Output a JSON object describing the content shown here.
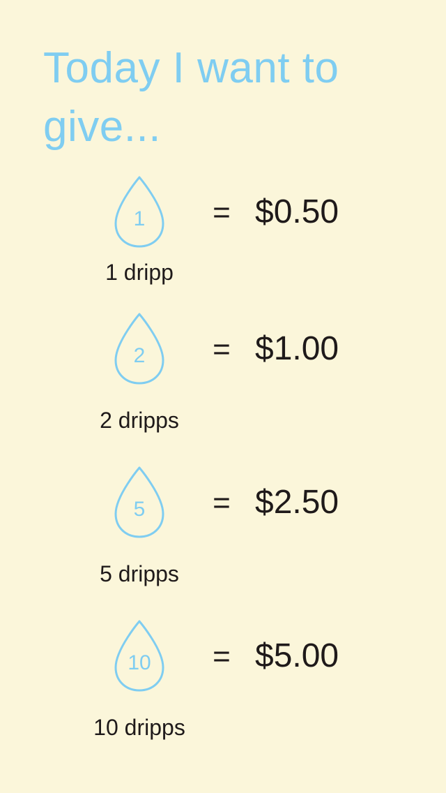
{
  "title": "Today I want to give...",
  "colors": {
    "background": "#fbf6da",
    "accent": "#7fcdf1",
    "text": "#1f1a1a"
  },
  "options": [
    {
      "drops": "1",
      "label": "1 dripp",
      "equals": "=",
      "amount": "$0.50"
    },
    {
      "drops": "2",
      "label": "2 dripps",
      "equals": "=",
      "amount": "$1.00"
    },
    {
      "drops": "5",
      "label": "5 dripps",
      "equals": "=",
      "amount": "$2.50"
    },
    {
      "drops": "10",
      "label": "10 dripps",
      "equals": "=",
      "amount": "$5.00"
    }
  ],
  "icons": {
    "drop": "water-drop-icon"
  }
}
